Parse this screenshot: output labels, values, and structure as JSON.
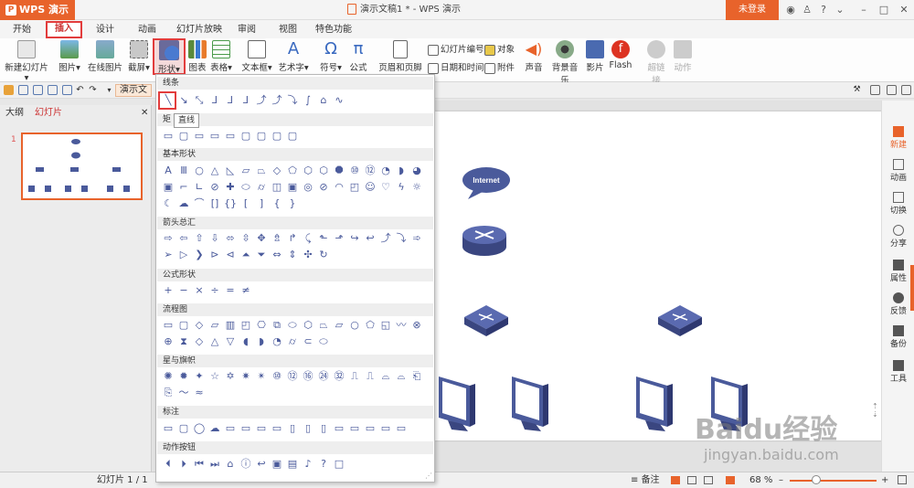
{
  "titlebar": {
    "app_name": "WPS 演示",
    "doc_title": "演示文稿1 * - WPS 演示",
    "login": "未登录"
  },
  "tabs": [
    "开始",
    "插入",
    "设计",
    "动画",
    "幻灯片放映",
    "审阅",
    "视图",
    "特色功能"
  ],
  "ribbon": {
    "new_slide": "新建幻灯片",
    "picture": "图片",
    "online_picture": "在线图片",
    "screenshot": "截屏",
    "shape": "形状",
    "chart": "图表",
    "table": "表格",
    "textbox": "文本框",
    "art_text": "艺术字",
    "symbol": "符号",
    "formula": "公式",
    "header_footer": "页眉和页脚",
    "slide_number": "幻灯片编号",
    "object": "对象",
    "datetime": "日期和时间",
    "attachment": "附件",
    "sound": "声音",
    "bg_music": "背景音乐",
    "movie": "影片",
    "flash": "Flash",
    "hyperlink": "超链接",
    "action": "动作"
  },
  "qtoolbar": {
    "presentation": "演示文"
  },
  "left_panel": {
    "outline": "大纲",
    "slides": "幻灯片",
    "slide_num": "1"
  },
  "dropdown": {
    "sections": [
      "线条",
      "矩",
      "基本形状",
      "箭头总汇",
      "公式形状",
      "流程图",
      "星与旗帜",
      "标注",
      "动作按钮"
    ],
    "tooltip": "直线"
  },
  "slide": {
    "internet_label": "Internet"
  },
  "right_sidebar": [
    "新建",
    "动画",
    "切换",
    "分享",
    "属性",
    "反馈",
    "备份",
    "工具"
  ],
  "status": {
    "slide_info": "幻灯片 1 / 1",
    "notes": "备注",
    "zoom": "68 %"
  },
  "watermark": {
    "main": "Baidu经验",
    "sub": "jingyan.baidu.com"
  },
  "colors": {
    "accent": "#e8632b",
    "highlight": "#e23c3c",
    "shape_blue": "#4a5a9b"
  }
}
